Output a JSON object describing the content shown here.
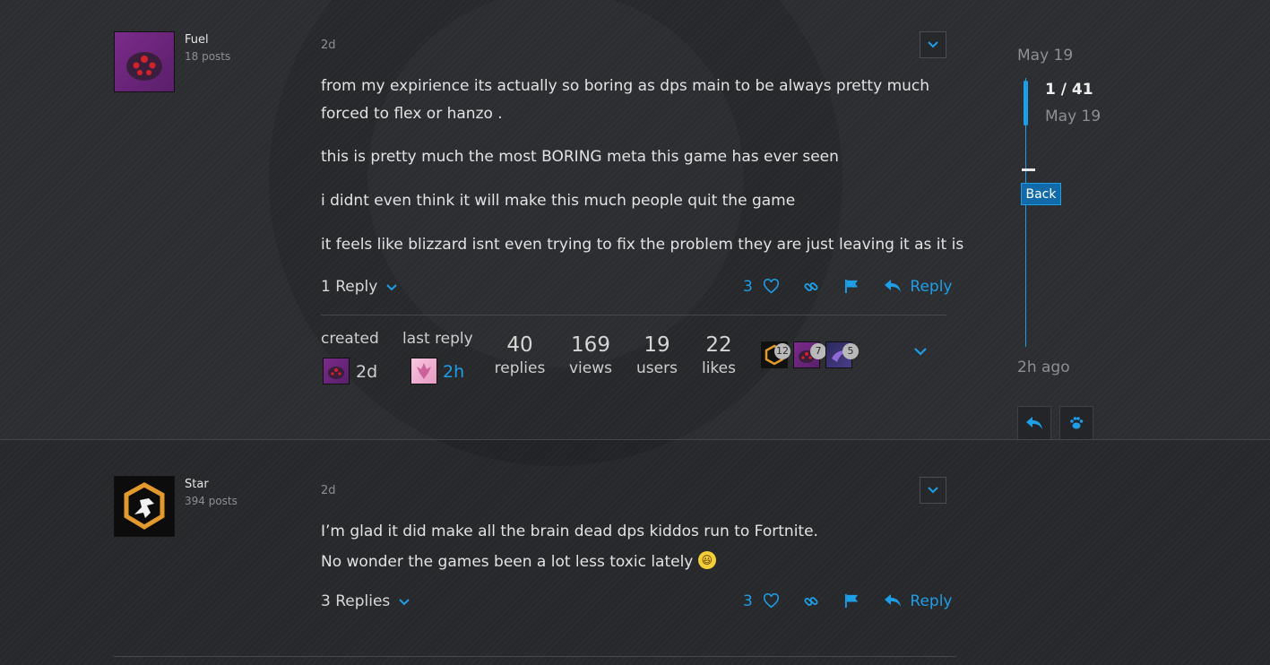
{
  "post1": {
    "username": "Fuel",
    "post_count": "18 posts",
    "date": "2d",
    "paragraphs": [
      "from my expirience its actually so boring as dps main to be always pretty much",
      "forced to flex or hanzo .",
      "this is pretty much the most BORING meta this game has ever seen",
      "i didnt even think it will make this much people quit the game",
      "it feels like blizzard isnt even trying to fix the problem they are just leaving it as it is"
    ],
    "replies_toggle": "1 Reply",
    "like_count": "3",
    "reply_label": "Reply"
  },
  "topic_meta": {
    "created_label": "created",
    "created_when": "2d",
    "last_reply_label": "last reply",
    "last_reply_when": "2h",
    "stats": [
      {
        "num": "40",
        "label": "replies"
      },
      {
        "num": "169",
        "label": "views"
      },
      {
        "num": "19",
        "label": "users"
      },
      {
        "num": "22",
        "label": "likes"
      }
    ],
    "participants": [
      {
        "count": "12"
      },
      {
        "count": "7"
      },
      {
        "count": "5"
      }
    ]
  },
  "post2": {
    "username": "Star",
    "post_count": "394 posts",
    "date": "2d",
    "lines": [
      "I’m glad it did make all the brain dead dps kiddos run to Fortnite.",
      "No wonder the games been a lot less toxic lately"
    ],
    "emoji": "😃",
    "replies_toggle": "3 Replies",
    "like_count": "3",
    "reply_label": "Reply"
  },
  "timeline": {
    "top_date": "May 19",
    "position": "1 / 41",
    "position_date": "May 19",
    "back_label": "Back",
    "bottom_date": "2h ago"
  },
  "colors": {
    "accent": "#1f9ee8",
    "background": "#2b2d30"
  }
}
